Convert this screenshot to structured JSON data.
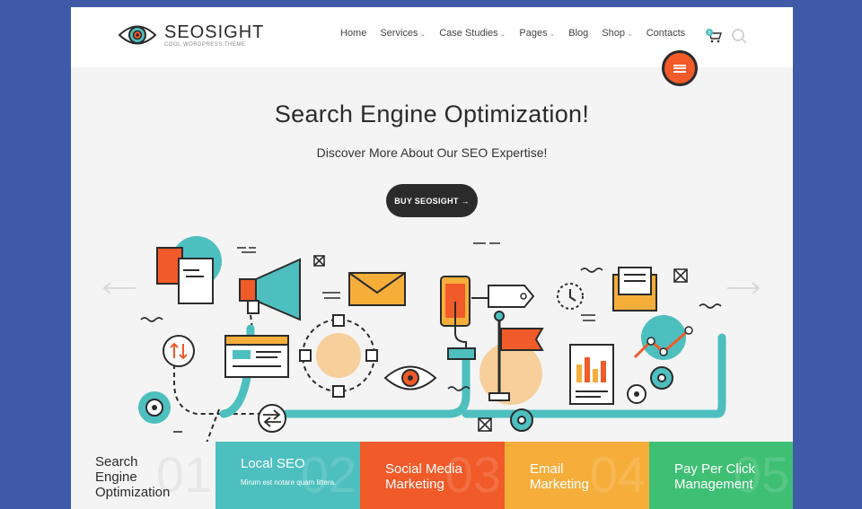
{
  "brand": {
    "name": "SEOSIGHT",
    "tagline": "COOL WORDPRESS THEME"
  },
  "nav": {
    "items": [
      {
        "label": "Home",
        "dropdown": false
      },
      {
        "label": "Services",
        "dropdown": true
      },
      {
        "label": "Case Studies",
        "dropdown": true
      },
      {
        "label": "Pages",
        "dropdown": true
      },
      {
        "label": "Blog",
        "dropdown": false
      },
      {
        "label": "Shop",
        "dropdown": true
      },
      {
        "label": "Contacts",
        "dropdown": false
      }
    ],
    "cart_count": "0"
  },
  "hero": {
    "title": "Search Engine Optimization!",
    "subtitle": "Discover More About Our SEO Expertise!",
    "button_label": "BUY SEOSIGHT →"
  },
  "tabs": [
    {
      "title_line1": "Search",
      "title_line2": "Engine",
      "title_line3": "Optimization",
      "number": "01",
      "body": ""
    },
    {
      "title_line1": "Local SEO",
      "title_line2": "",
      "title_line3": "",
      "number": "02",
      "body": "Mirum est notare quam littera."
    },
    {
      "title_line1": "Social Media",
      "title_line2": "Marketing",
      "title_line3": "",
      "number": "03",
      "body": ""
    },
    {
      "title_line1": "Email",
      "title_line2": "Marketing",
      "title_line3": "",
      "number": "04",
      "body": ""
    },
    {
      "title_line1": "Pay Per Click",
      "title_line2": "Management",
      "title_line3": "",
      "number": "05",
      "body": ""
    }
  ],
  "colors": {
    "background": "#3f5aa6",
    "accent_orange": "#f15a29",
    "teal": "#4ebfbf",
    "yellow": "#f6ae3b",
    "green": "#3fbf74",
    "dark": "#2b2b2b"
  }
}
